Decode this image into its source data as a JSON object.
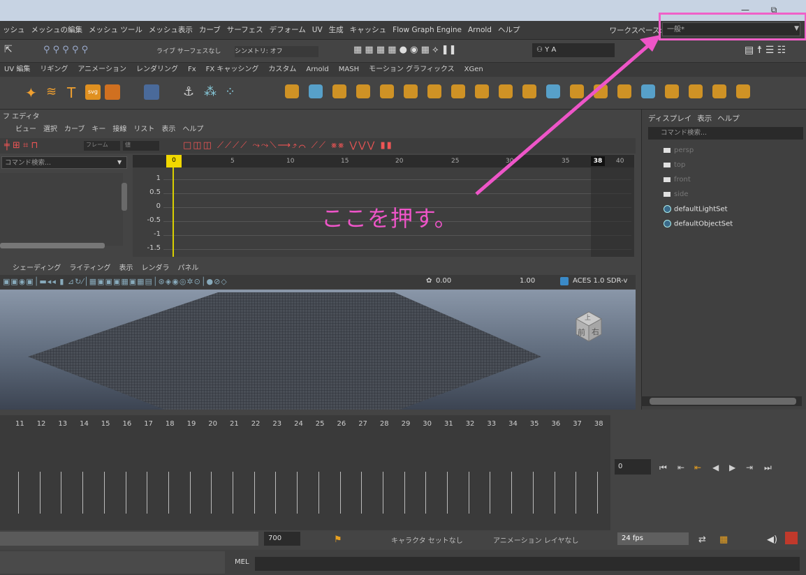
{
  "window": {
    "minimize_label": "—",
    "restore_label": "⧉"
  },
  "menubar": {
    "items": [
      "ッシュ",
      "メッシュの編集",
      "メッシュ ツール",
      "メッシュ表示",
      "カーブ",
      "サーフェス",
      "デフォーム",
      "UV",
      "生成",
      "キャッシュ",
      "Flow Graph Engine",
      "Arnold",
      "ヘルプ"
    ],
    "workspace_label": "ワークスペース:",
    "workspace_value": "一般*"
  },
  "statusline": {
    "live_surface": "ライブ サーフェスなし",
    "symmetry": "シンメトリ: オフ",
    "user": "Y A"
  },
  "shelf_tabs": [
    "UV 編集",
    "リギング",
    "アニメーション",
    "レンダリング",
    "Fx",
    "FX キャッシング",
    "カスタム",
    "Arnold",
    "MASH",
    "モーション グラフィックス",
    "XGen"
  ],
  "graph_editor": {
    "title": "フ エディタ",
    "menu": [
      "ビュー",
      "選択",
      "カーブ",
      "キー",
      "接線",
      "リスト",
      "表示",
      "ヘルプ"
    ],
    "frame_label": "フレーム",
    "value_label": "値",
    "search_placeholder": "コマンド検索...",
    "ruler": [
      "0",
      "5",
      "10",
      "15",
      "20",
      "25",
      "30",
      "35",
      "38",
      "40"
    ],
    "y_values": [
      "1",
      "0.5",
      "0",
      "-0.5",
      "-1",
      "-1.5"
    ],
    "current_frame": "0",
    "end_frame": "38"
  },
  "viewport": {
    "menu": [
      "シェーディング",
      "ライティング",
      "表示",
      "レンダラ",
      "パネル"
    ],
    "val1": "0.00",
    "val2": "1.00",
    "colorspace": "ACES 1.0 SDR-v",
    "cube_top": "上",
    "cube_front": "前",
    "cube_right": "右"
  },
  "outliner": {
    "menu": [
      "ディスプレイ",
      "表示",
      "ヘルプ"
    ],
    "search_placeholder": "コマンド検索...",
    "cameras": [
      "persp",
      "top",
      "front",
      "side"
    ],
    "sets": [
      "defaultLightSet",
      "defaultObjectSet"
    ]
  },
  "timeslider": {
    "frames": [
      "11",
      "12",
      "13",
      "14",
      "15",
      "16",
      "17",
      "18",
      "19",
      "20",
      "21",
      "22",
      "23",
      "24",
      "25",
      "26",
      "27",
      "28",
      "29",
      "30",
      "31",
      "32",
      "33",
      "34",
      "35",
      "36",
      "37",
      "38"
    ],
    "current_frame": "0"
  },
  "range": {
    "end_value": "700",
    "character_set": "キャラクタ セットなし",
    "anim_layer": "アニメーション レイヤなし",
    "fps": "24 fps"
  },
  "cmdline": {
    "mel_label": "MEL"
  },
  "annotation": {
    "text": "ここを押す。",
    "color": "#ee55c8"
  }
}
